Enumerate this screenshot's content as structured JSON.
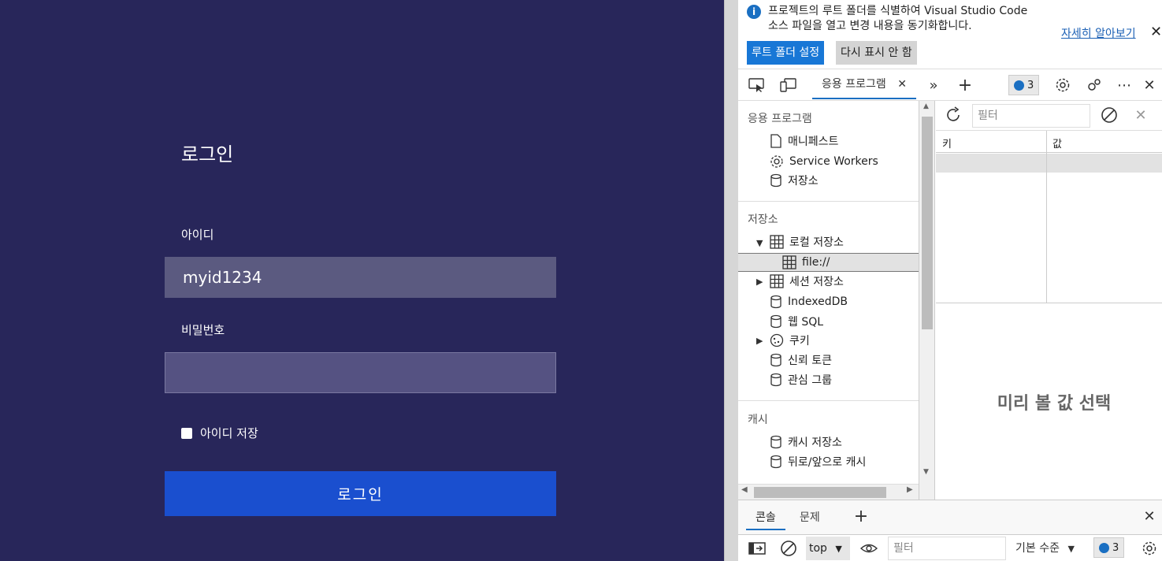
{
  "login": {
    "title": "로그인",
    "id_label": "아이디",
    "id_value": "myid1234",
    "password_label": "비밀번호",
    "password_value": "",
    "remember_label": "아이디 저장",
    "remember_checked": false,
    "submit_label": "로그인"
  },
  "infobar": {
    "text_line1": "프로젝트의 루트 폴더를 식별하여 Visual Studio Code",
    "text_line2": "소스 파일을 열고 변경 내용을 동기화합니다.",
    "learn_more": "자세히 알아보기",
    "set_root_button": "루트 폴더 설정",
    "dont_show_button": "다시 표시 안 함"
  },
  "toolbar": {
    "active_tab": "응용 프로그램",
    "issues_count": "3"
  },
  "sidebar": {
    "app_heading": "응용 프로그램",
    "app_items": [
      "매니페스트",
      "Service Workers",
      "저장소"
    ],
    "storage_heading": "저장소",
    "storage_items": {
      "local_storage": "로컬 저장소",
      "local_file": "file://",
      "session_storage": "세션 저장소",
      "indexeddb": "IndexedDB",
      "websql": "웹 SQL",
      "cookies": "쿠키",
      "trust_tokens": "신뢰 토큰",
      "interest_groups": "관심 그룹"
    },
    "cache_heading": "캐시",
    "cache_items": [
      "캐시 저장소",
      "뒤로/앞으로 캐시"
    ]
  },
  "main": {
    "filter_placeholder": "필터",
    "col_key": "키",
    "col_value": "값",
    "preview_placeholder": "미리 볼 값 선택"
  },
  "drawer": {
    "tab_console": "콘솔",
    "tab_issues": "문제",
    "context": "top",
    "filter_placeholder": "필터",
    "level": "기본 수준",
    "issues_count": "3"
  },
  "colors": {
    "login_bg": "#28265a",
    "input_bg": "#5b5a80",
    "login_button": "#1a4fcf",
    "accent": "#1a6fc2"
  }
}
